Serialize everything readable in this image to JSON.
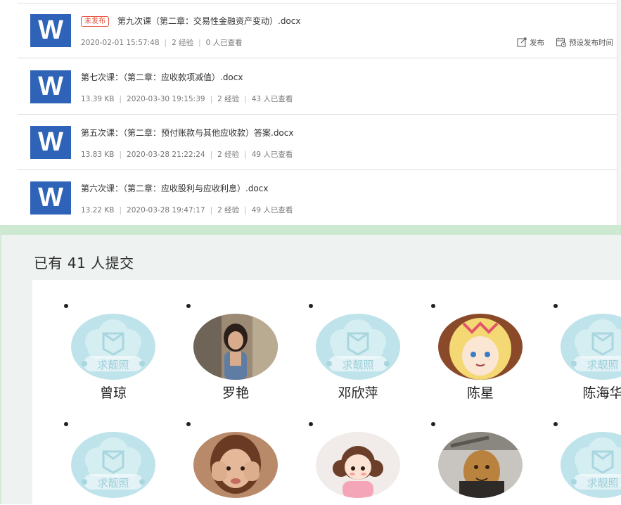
{
  "files": [
    {
      "icon": "word-icon",
      "icon_letter": "W",
      "tag": "未发布",
      "title": "第九次课（第二章：交易性金融资产变动）.docx",
      "meta": [
        "2020-02-01 15:57:48",
        "2 经验",
        "0 人已查看"
      ],
      "actions": {
        "publish": "发布",
        "schedule": "预设发布时间"
      }
    },
    {
      "icon": "word-icon",
      "icon_letter": "W",
      "title": "第七次课：（第二章：应收款项减值）.docx",
      "meta": [
        "13.39 KB",
        "2020-03-30 19:15:39",
        "2 经验",
        "43 人已查看"
      ]
    },
    {
      "icon": "word-icon",
      "icon_letter": "W",
      "title": "第五次课：（第二章：预付账款与其他应收款）答案.docx",
      "meta": [
        "13.83 KB",
        "2020-03-28 21:22:24",
        "2 经验",
        "49 人已查看"
      ]
    },
    {
      "icon": "word-icon",
      "icon_letter": "W",
      "title": "第六次课：（第二章：应收股利与应收利息）.docx",
      "meta": [
        "13.22 KB",
        "2020-03-28 19:47:17",
        "2 经验",
        "49 人已查看"
      ]
    }
  ],
  "submissions": {
    "title": "已有 41 人提交",
    "placeholder_watermark": "求靓照",
    "people": [
      {
        "name": "曾琼",
        "avatar": "placeholder-avatar"
      },
      {
        "name": "罗艳",
        "avatar": "photo-girl-street"
      },
      {
        "name": "邓欣萍",
        "avatar": "placeholder-avatar"
      },
      {
        "name": "陈星",
        "avatar": "anime-girl"
      },
      {
        "name": "陈海华",
        "avatar": "placeholder-avatar"
      },
      {
        "name": "",
        "avatar": "placeholder-avatar"
      },
      {
        "name": "",
        "avatar": "photo-child-hands"
      },
      {
        "name": "",
        "avatar": "cartoon-girl-pigtails"
      },
      {
        "name": "",
        "avatar": "meme-potato-face"
      },
      {
        "name": "",
        "avatar": "placeholder-avatar"
      }
    ]
  },
  "colors": {
    "word_blue": "#2f63b8",
    "tag_red": "#e5533f",
    "panel_green": "#cde9d2",
    "placeholder_teal": "#bfe3ea"
  }
}
